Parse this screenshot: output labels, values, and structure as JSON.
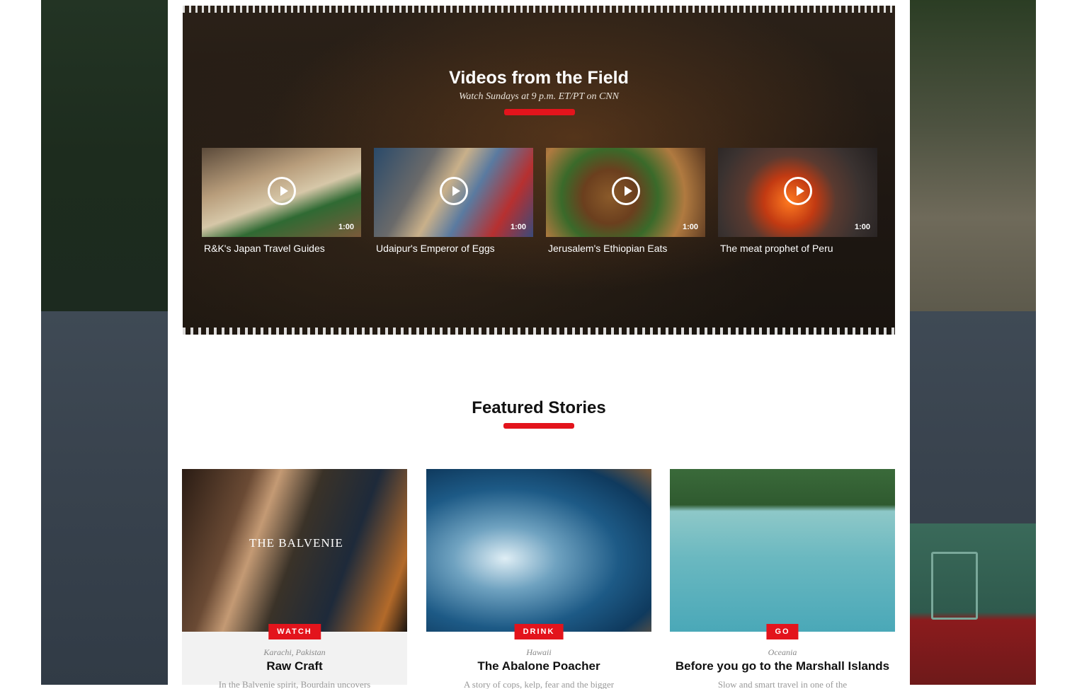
{
  "videos": {
    "title": "Videos from the Field",
    "subtitle": "Watch Sundays at 9 p.m. ET/PT on CNN",
    "items": [
      {
        "label": "R&K's Japan Travel Guides",
        "duration": "1:00"
      },
      {
        "label": "Udaipur's Emperor of Eggs",
        "duration": "1:00"
      },
      {
        "label": "Jerusalem's Ethiopian Eats",
        "duration": "1:00"
      },
      {
        "label": "The meat prophet of Peru",
        "duration": "1:00"
      }
    ]
  },
  "featured": {
    "title": "Featured Stories",
    "stories": [
      {
        "tag": "WATCH",
        "location": "Karachi, Pakistan",
        "title": "Raw Craft",
        "desc": "In the Balvenie spirit, Bourdain uncovers",
        "image_text": "THE BALVENIE"
      },
      {
        "tag": "DRINK",
        "location": "Hawaii",
        "title": "The Abalone Poacher",
        "desc": "A story of cops, kelp, fear and the bigger"
      },
      {
        "tag": "GO",
        "location": "Oceania",
        "title": "Before you go to the Marshall Islands",
        "desc": "Slow and smart travel in one of the"
      }
    ]
  },
  "colors": {
    "accent": "#e3141c"
  }
}
